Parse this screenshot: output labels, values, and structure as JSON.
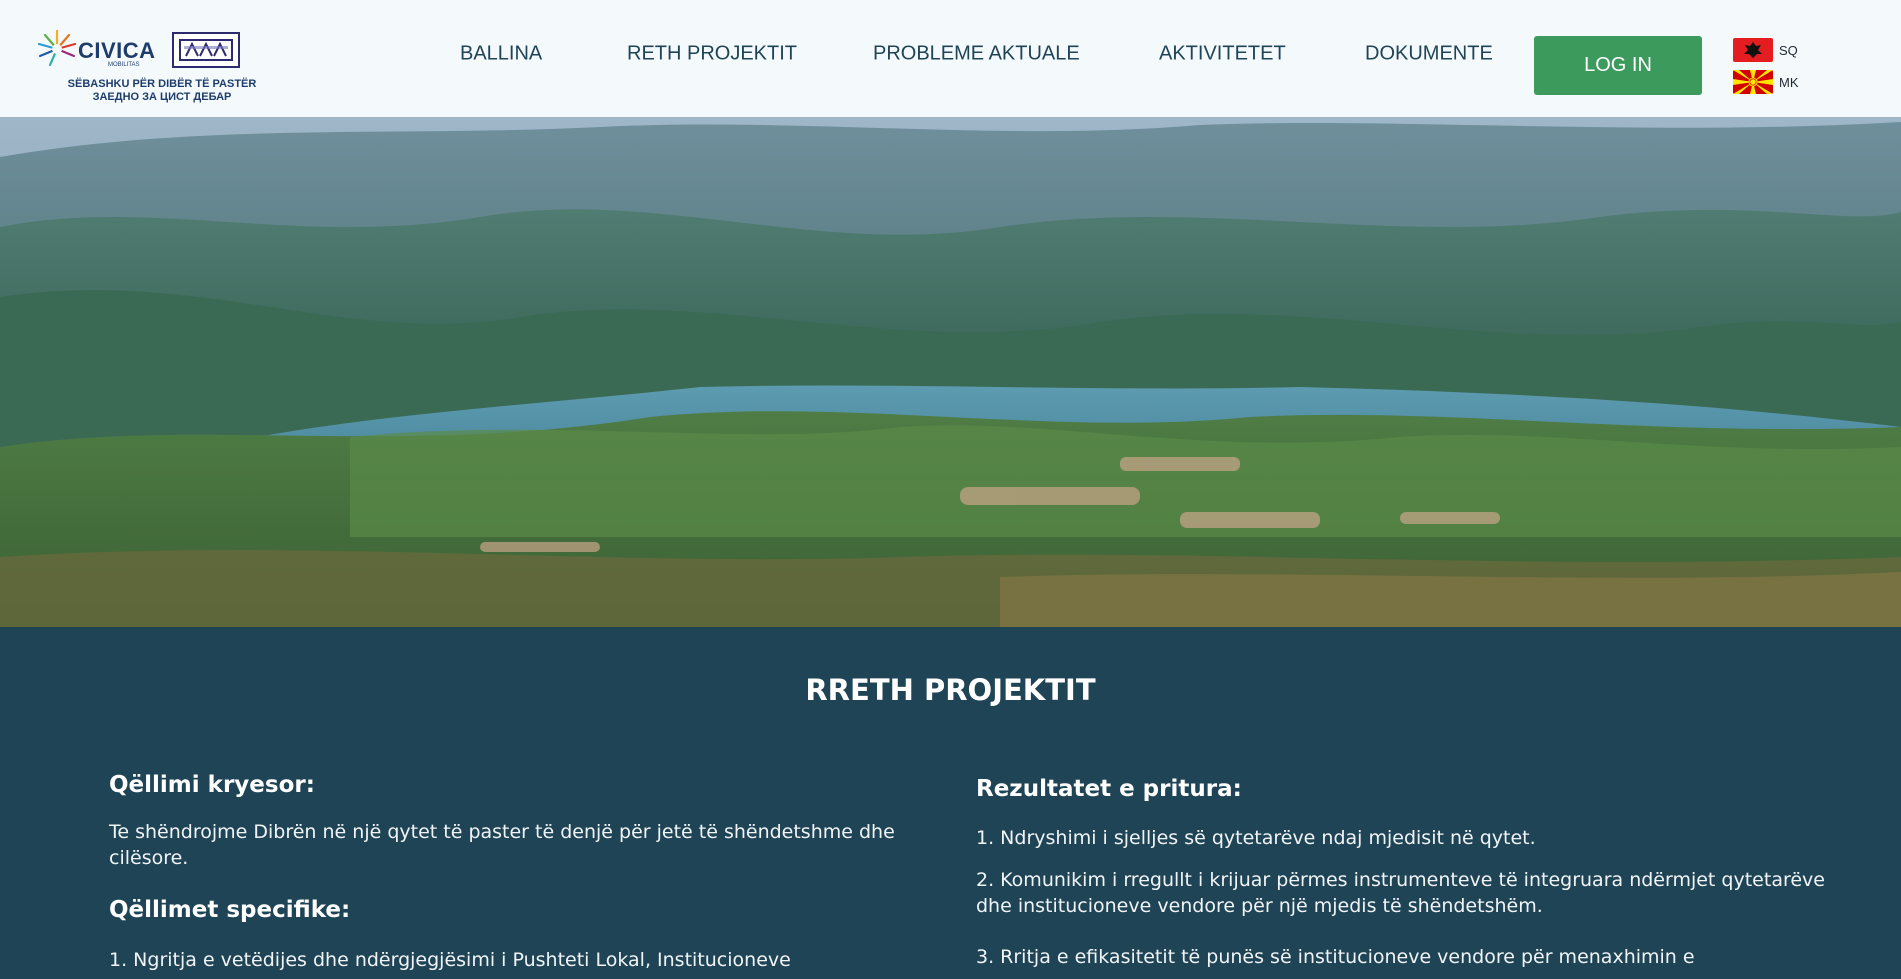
{
  "header": {
    "logo": {
      "name": "CIVICA",
      "sub": "MOBILITAS",
      "tagline_sq": "SËBASHKU PËR DIBËR TË PASTËR",
      "tagline_mk": "ЗАЕДНО ЗА ЦИСТ ДЕБАР"
    },
    "nav": [
      "BALLINA",
      "RETH PROJEKTIT",
      "PROBLEME AKTUALE",
      "AKTIVITETET",
      "DOKUMENTE"
    ],
    "login_label": "LOG IN",
    "languages": [
      {
        "code": "SQ",
        "flag": "albania-flag-icon"
      },
      {
        "code": "MK",
        "flag": "north-macedonia-flag-icon"
      }
    ]
  },
  "hero": {
    "image": "mountain-lake-valley-landscape"
  },
  "section": {
    "title": "RRETH PROJEKTIT",
    "left": {
      "main_goal_heading": "Qëllimi kryesor:",
      "main_goal_text": "Te shëndrojme Dibrën në një qytet të paster të denjë për jetë të shëndetshme dhe cilësore.",
      "specific_heading": "Qëllimet specifike:",
      "specific_item_1": "1. Ngritja e vetëdijes dhe ndërgjegjësimi i Pushteti Lokal, Institucioneve"
    },
    "right": {
      "results_heading": "Rezultatet e pritura:",
      "result_1": "1. Ndryshimi i sjelljes së qytetarëve ndaj mjedisit në qytet.",
      "result_2": "2. Komunikim i rregullt i krijuar përmes instrumenteve të integruara ndërmjet qytetarëve dhe institucioneve vendore për një mjedis të shëndetshëm.",
      "result_3": "3. Rritja e efikasitetit të punës së institucioneve vendore për menaxhimin e"
    }
  },
  "colors": {
    "header_bg": "#f4f9fc",
    "nav_text": "#1f4456",
    "login_bg": "#3c9a5c",
    "content_bg": "#1f4456"
  }
}
